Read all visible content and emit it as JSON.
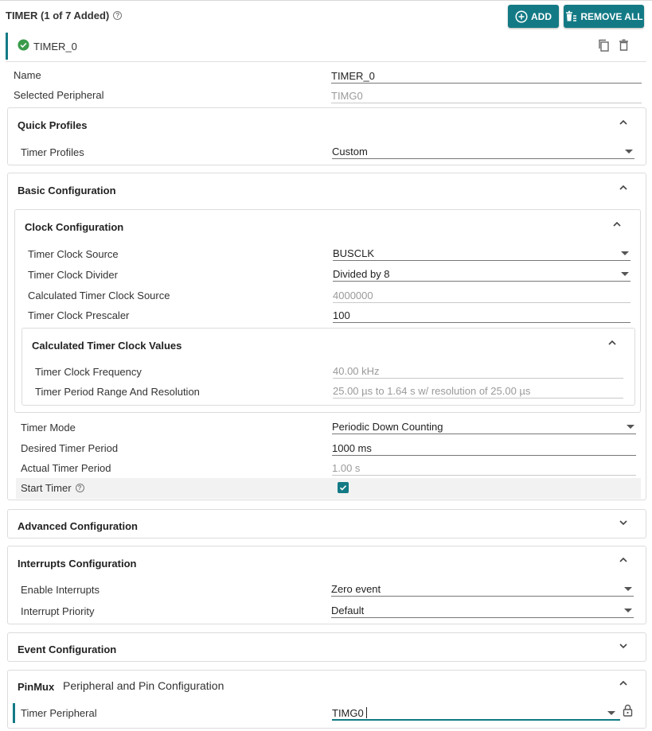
{
  "header": {
    "title": "TIMER (1 of 7 Added)",
    "add_label": "ADD",
    "remove_all_label": "REMOVE ALL"
  },
  "instance": {
    "name": "TIMER_0",
    "status_icon": "check-circle-icon",
    "copy_icon": "copy-icon",
    "delete_icon": "trash-icon"
  },
  "general": {
    "name_label": "Name",
    "name_value": "TIMER_0",
    "peripheral_label": "Selected Peripheral",
    "peripheral_value": "TIMG0"
  },
  "quick_profiles": {
    "title": "Quick Profiles",
    "timer_profiles_label": "Timer Profiles",
    "timer_profiles_value": "Custom"
  },
  "basic": {
    "title": "Basic Configuration",
    "clock": {
      "title": "Clock Configuration",
      "source_label": "Timer Clock Source",
      "source_value": "BUSCLK",
      "divider_label": "Timer Clock Divider",
      "divider_value": "Divided by 8",
      "calc_source_label": "Calculated Timer Clock Source",
      "calc_source_value": "4000000",
      "prescaler_label": "Timer Clock Prescaler",
      "prescaler_value": "100",
      "calc": {
        "title": "Calculated Timer Clock Values",
        "freq_label": "Timer Clock Frequency",
        "freq_value": "40.00 kHz",
        "range_label": "Timer Period Range And Resolution",
        "range_value": "25.00 µs to 1.64 s w/ resolution of 25.00 µs"
      }
    },
    "mode_label": "Timer Mode",
    "mode_value": "Periodic Down Counting",
    "desired_label": "Desired Timer Period",
    "desired_value": "1000 ms",
    "actual_label": "Actual Timer Period",
    "actual_value": "1.00 s",
    "start_label": "Start Timer",
    "start_checked": true
  },
  "advanced": {
    "title": "Advanced Configuration"
  },
  "interrupts": {
    "title": "Interrupts Configuration",
    "enable_label": "Enable Interrupts",
    "enable_value": "Zero event",
    "priority_label": "Interrupt Priority",
    "priority_value": "Default"
  },
  "events": {
    "title": "Event Configuration"
  },
  "pinmux": {
    "tag": "PinMux",
    "title": "Peripheral and Pin Configuration",
    "peripheral_label": "Timer Peripheral",
    "peripheral_value": "TIMG0"
  },
  "colors": {
    "accent": "#137a85",
    "border": "#dcdcdc",
    "text": "#333333",
    "muted": "#9a9a9a"
  }
}
